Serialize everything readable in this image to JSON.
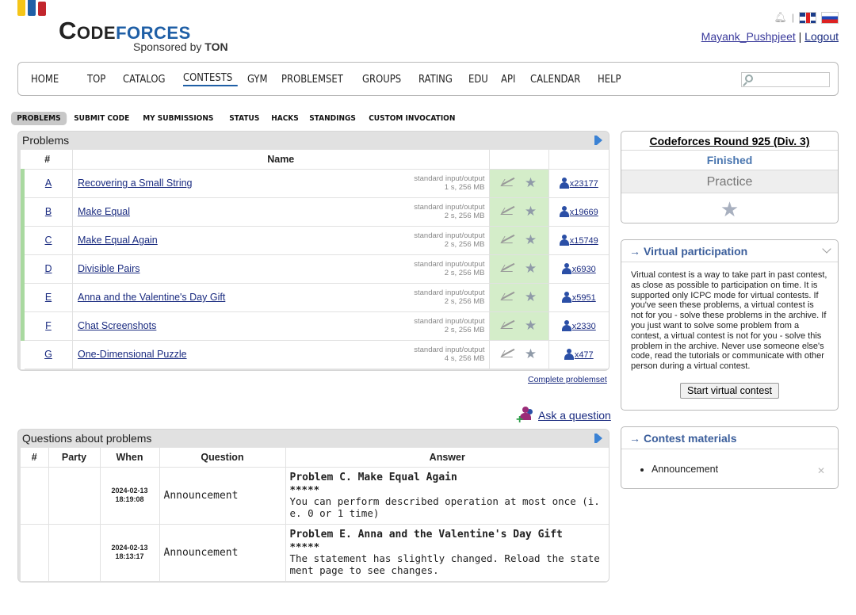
{
  "header": {
    "logo_word1": "Code",
    "logo_word2": "forces",
    "sponsor_prefix": "Sponsored by",
    "sponsor_name": "TON",
    "username": "Mayank_Pushpjeet",
    "separator": "|",
    "logout": "Logout",
    "bar_colors": [
      "#f5c518",
      "#1f5fa6",
      "#c2262d"
    ]
  },
  "main_menu": [
    "HOME",
    "TOP",
    "CATALOG",
    "CONTESTS",
    "GYM",
    "PROBLEMSET",
    "GROUPS",
    "RATING",
    "EDU",
    "API",
    "CALENDAR",
    "HELP"
  ],
  "main_menu_current": "CONTESTS",
  "search": {
    "value": "",
    "placeholder": ""
  },
  "second_menu": [
    "PROBLEMS",
    "SUBMIT CODE",
    "MY SUBMISSIONS",
    "STATUS",
    "HACKS",
    "STANDINGS",
    "CUSTOM INVOCATION"
  ],
  "second_menu_current": "PROBLEMS",
  "problems": {
    "title": "Problems",
    "headers": {
      "id": "#",
      "name": "Name"
    },
    "rows": [
      {
        "id": "A",
        "name": "Recovering a Small String",
        "io": "standard input/output",
        "limits": "1 s, 256 MB",
        "solved": "x23177"
      },
      {
        "id": "B",
        "name": "Make Equal",
        "io": "standard input/output",
        "limits": "2 s, 256 MB",
        "solved": "x19669"
      },
      {
        "id": "C",
        "name": "Make Equal Again",
        "io": "standard input/output",
        "limits": "2 s, 256 MB",
        "solved": "x15749"
      },
      {
        "id": "D",
        "name": "Divisible Pairs",
        "io": "standard input/output",
        "limits": "2 s, 256 MB",
        "solved": "x6930"
      },
      {
        "id": "E",
        "name": "Anna and the Valentine's Day Gift",
        "io": "standard input/output",
        "limits": "2 s, 256 MB",
        "solved": "x5951"
      },
      {
        "id": "F",
        "name": "Chat Screenshots",
        "io": "standard input/output",
        "limits": "2 s, 256 MB",
        "solved": "x2330"
      },
      {
        "id": "G",
        "name": "One-Dimensional Puzzle",
        "io": "standard input/output",
        "limits": "4 s, 256 MB",
        "solved": "x477"
      }
    ],
    "complete_link": "Complete problemset"
  },
  "ask_question": "Ask a question",
  "questions": {
    "title": "Questions about problems",
    "headers": {
      "id": "#",
      "party": "Party",
      "when": "When",
      "question": "Question",
      "answer": "Answer"
    },
    "rows": [
      {
        "date": "2024-02-13",
        "time": "18:19:08",
        "question": "Announcement",
        "answer_title": "Problem C. Make Equal Again",
        "answer_stars": "*****",
        "answer_body": "You can perform described operation at most once (i.e. 0 or 1 time)"
      },
      {
        "date": "2024-02-13",
        "time": "18:13:17",
        "question": "Announcement",
        "answer_title": "Problem E. Anna and the Valentine's Day Gift",
        "answer_stars": "*****",
        "answer_body": "The statement has slightly changed. Reload the statement page to see changes."
      }
    ]
  },
  "contest": {
    "name": "Codeforces Round 925 (Div. 3)",
    "status": "Finished",
    "mode": "Practice"
  },
  "virtual": {
    "title": "Virtual participation",
    "text": "Virtual contest is a way to take part in past contest, as close as possible to participation on time. It is supported only ICPC mode for virtual contests. If you've seen these problems, a virtual contest is not for you - solve these problems in the archive. If you just want to solve some problem from a contest, a virtual contest is not for you - solve this problem in the archive. Never use someone else's code, read the tutorials or communicate with other person during a virtual contest.",
    "button": "Start virtual contest"
  },
  "materials": {
    "title": "Contest materials",
    "items": [
      "Announcement"
    ]
  },
  "arrow_glyph": "→"
}
